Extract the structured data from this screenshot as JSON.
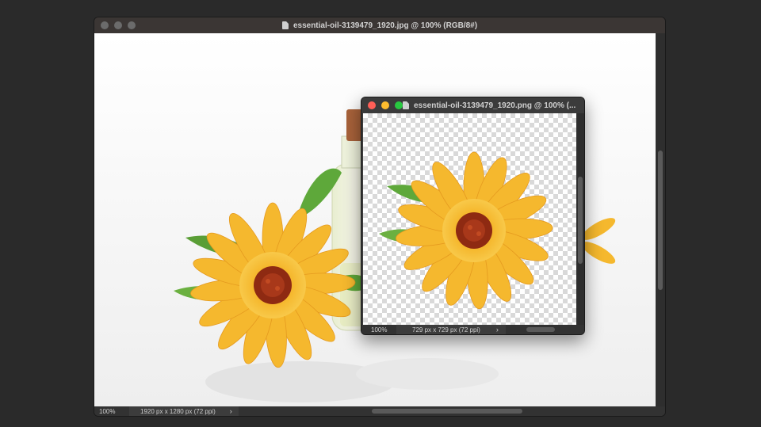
{
  "main_window": {
    "title": "essential-oil-3139479_1920.jpg @ 100% (RGB/8#)",
    "status": {
      "zoom": "100%",
      "dimensions": "1920 px x 1280 px (72 ppi)"
    }
  },
  "png_window": {
    "title": "essential-oil-3139479_1920.png @ 100% (...",
    "status": {
      "zoom": "100%",
      "dimensions": "729 px x 729 px (72 ppi)"
    }
  },
  "icons": {
    "document": "document-icon",
    "chevron": "chevron-right-icon"
  },
  "colors": {
    "desktop": "#2a2a2a",
    "close": "#ff5f57",
    "minimize": "#febc2e",
    "maximize": "#28c840",
    "inactive_light": "#6b6b6b",
    "petal": "#f5b82e",
    "flower_center": "#8e2a12",
    "leaf": "#5ea83a"
  }
}
